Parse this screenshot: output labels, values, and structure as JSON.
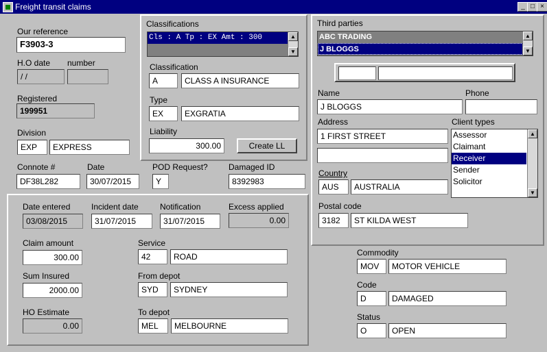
{
  "window": {
    "title": "Freight transit claims"
  },
  "reference": {
    "our_reference_label": "Our reference",
    "our_reference": "F3903-3",
    "ho_date_label": "H.O date",
    "ho_number_label": "number",
    "ho_date": " / /",
    "ho_number": "",
    "registered_label": "Registered",
    "registered": "199951"
  },
  "division": {
    "label": "Division",
    "code": "EXP",
    "name": "EXPRESS"
  },
  "classifications": {
    "label": "Classifications",
    "list_item": "Cls :  A Tp : EX   Amt : 300",
    "classification_label": "Classification",
    "classification_code": "A",
    "classification_name": "CLASS A INSURANCE",
    "type_label": "Type",
    "type_code": "EX",
    "type_name": "EXGRATIA",
    "liability_label": "Liability",
    "liability": "300.00",
    "create_ll_label": "Create LL"
  },
  "connote": {
    "connote_label": "Connote #",
    "connote": "DF38L282",
    "date_label": "Date",
    "date": "30/07/2015",
    "pod_label": "POD Request?",
    "pod": "Y",
    "damaged_id_label": "Damaged ID",
    "damaged_id": "8392983"
  },
  "claim": {
    "date_entered_label": "Date entered",
    "date_entered": "03/08/2015",
    "incident_date_label": "Incident date",
    "incident_date": "31/07/2015",
    "notification_label": "Notification",
    "notification": "31/07/2015",
    "excess_label": "Excess applied",
    "excess": "0.00",
    "claim_amount_label": "Claim amount",
    "claim_amount": "300.00",
    "sum_insured_label": "Sum Insured",
    "sum_insured": "2000.00",
    "ho_estimate_label": "HO Estimate",
    "ho_estimate": "0.00",
    "service_label": "Service",
    "service_code": "42",
    "service_name": "ROAD",
    "from_depot_label": "From depot",
    "from_code": "SYD",
    "from_name": "SYDNEY",
    "to_depot_label": "To depot",
    "to_code": "MEL",
    "to_name": "MELBOURNE"
  },
  "third_parties": {
    "label": "Third parties",
    "items": [
      "ABC TRADING",
      "J BLOGGS"
    ],
    "name_label": "Name",
    "name": "J BLOGGS",
    "phone_label": "Phone",
    "phone": "",
    "address_label": "Address",
    "address1": "1 FIRST STREET",
    "address2": "",
    "client_types_label": "Client types",
    "client_types": [
      "Assessor",
      "Claimant",
      "Receiver",
      "Sender",
      "Solicitor"
    ],
    "country_label": "Country",
    "country_code": "AUS",
    "country_name": "AUSTRALIA",
    "postal_label": "Postal code",
    "postal_code": "3182",
    "postal_name": "ST KILDA WEST"
  },
  "goods": {
    "commodity_label": "Commodity",
    "commodity_code": "MOV",
    "commodity_name": "MOTOR VEHICLE",
    "code_label": "Code",
    "code": "D",
    "code_name": "DAMAGED",
    "status_label": "Status",
    "status_code": "O",
    "status_name": "OPEN"
  },
  "colors": {
    "title_bar": "#000080",
    "selection": "#000080",
    "face": "#c0c0c0"
  }
}
